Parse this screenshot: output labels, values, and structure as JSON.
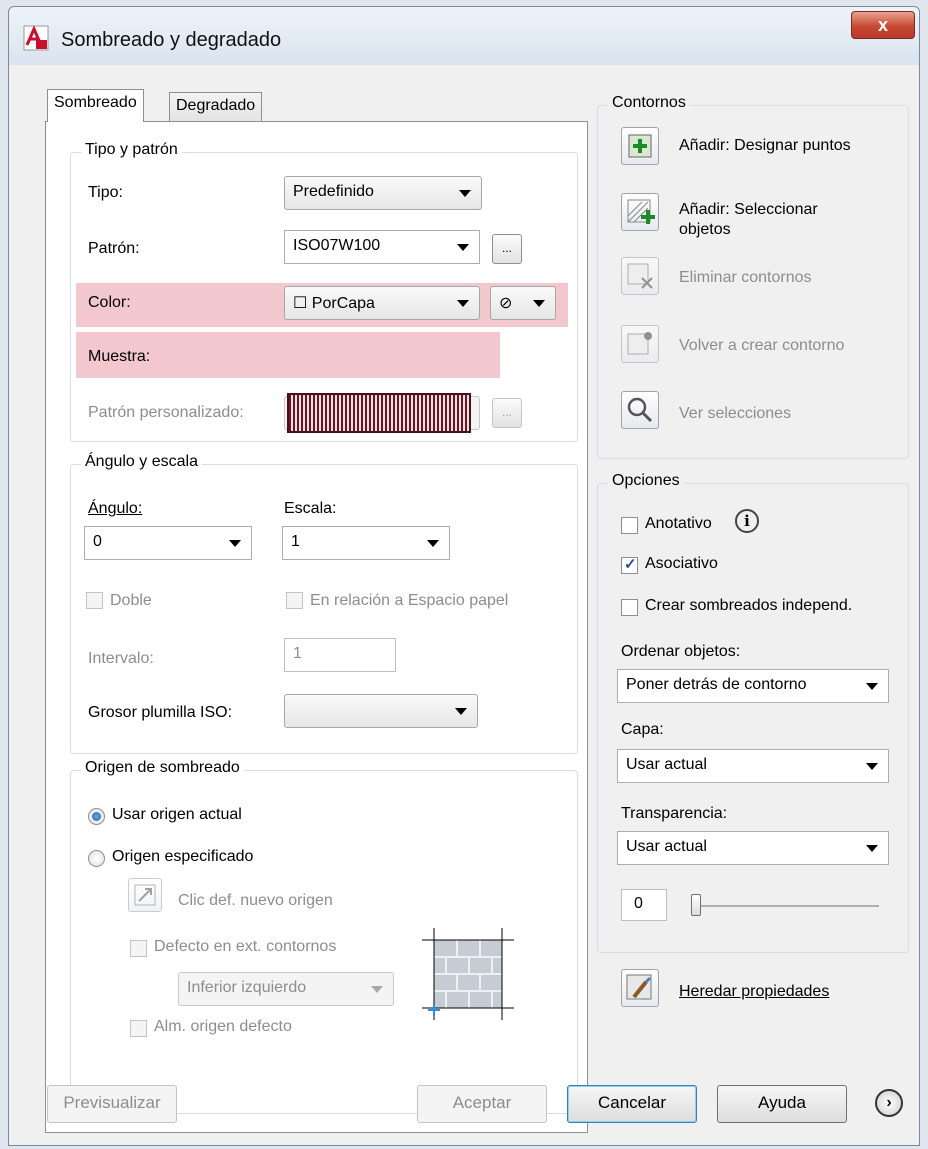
{
  "window": {
    "title": "Sombreado y degradado",
    "close_label": "x"
  },
  "tabs": [
    {
      "label": "Sombreado",
      "active": true
    },
    {
      "label": "Degradado",
      "active": false
    }
  ],
  "tipo_patron": {
    "group_label": "Tipo y patrón",
    "tipo_label": "Tipo:",
    "tipo_value": "Predefinido",
    "patron_label": "Patrón:",
    "patron_value": "ISO07W100",
    "browse_label": "...",
    "color_label": "Color:",
    "color_value": "PorCapa",
    "color_symbol": "☐",
    "bgcolor_symbol": "⊘",
    "muestra_label": "Muestra:",
    "personalizado_label": "Patrón personalizado:",
    "personalizado_value": "",
    "personalizado_browse": "..."
  },
  "angulo_escala": {
    "group_label": "Ángulo y escala",
    "angulo_label": "Ángulo:",
    "angulo_value": "0",
    "escala_label": "Escala:",
    "escala_value": "1",
    "doble_label": "Doble",
    "espacio_papel_label": "En relación a Espacio papel",
    "intervalo_label": "Intervalo:",
    "intervalo_value": "1",
    "grosor_label": "Grosor plumilla ISO:",
    "grosor_value": ""
  },
  "origen": {
    "group_label": "Origen de sombreado",
    "usar_actual_label": "Usar origen actual",
    "especificado_label": "Origen especificado",
    "clic_label": "Clic def. nuevo origen",
    "defecto_label": "Defecto en ext. contornos",
    "posicion_value": "Inferior izquierdo",
    "alm_label": "Alm. origen defecto"
  },
  "contornos": {
    "group_label": "Contornos",
    "designar_label": "Añadir: Designar puntos",
    "seleccionar_label": "Añadir: Seleccionar",
    "seleccionar_label2": "objetos",
    "eliminar_label": "Eliminar contornos",
    "volver_label": "Volver a crear contorno",
    "ver_label": "Ver selecciones"
  },
  "opciones": {
    "group_label": "Opciones",
    "anotativo_label": "Anotativo",
    "asociativo_label": "Asociativo",
    "asociativo_checked": true,
    "independ_label": "Crear sombreados independ.",
    "ordenar_label": "Ordenar objetos:",
    "ordenar_value": "Poner detrás de contorno",
    "capa_label": "Capa:",
    "capa_value": "Usar actual",
    "transparencia_label": "Transparencia:",
    "transparencia_value": "Usar actual",
    "transparencia_level": "0",
    "heredar_label": "Heredar propiedades"
  },
  "footer": {
    "previsualizar": "Previsualizar",
    "aceptar": "Aceptar",
    "cancelar": "Cancelar",
    "ayuda": "Ayuda"
  },
  "colors": {
    "highlight": "#f2c7cd",
    "close_button": "#c74a33",
    "sample_pattern": "#6a1424"
  }
}
